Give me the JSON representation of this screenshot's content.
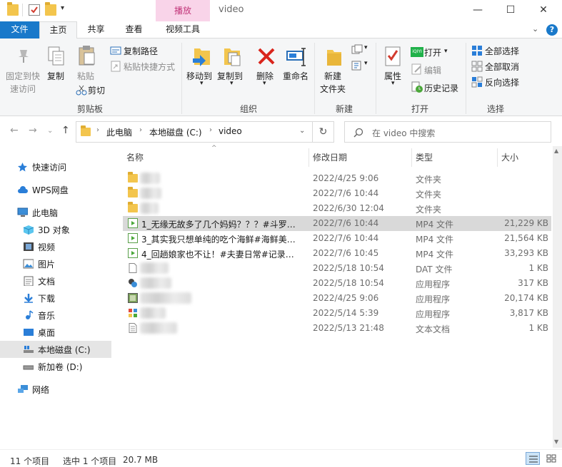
{
  "window": {
    "title": "video",
    "context_tab": "播放"
  },
  "tabs": {
    "file": "文件",
    "home": "主页",
    "share": "共享",
    "view": "查看",
    "video_tools": "视频工具"
  },
  "ribbon": {
    "clipboard": {
      "pin": "固定到快",
      "pin2": "速访问",
      "copy": "复制",
      "paste": "粘贴",
      "copy_path": "复制路径",
      "paste_shortcut": "粘贴快捷方式",
      "cut": "剪切",
      "group": "剪贴板"
    },
    "organize": {
      "move_to": "移动到",
      "copy_to": "复制到",
      "delete": "删除",
      "rename": "重命名",
      "group": "组织"
    },
    "new": {
      "new_folder": "新建",
      "new_folder2": "文件夹",
      "group": "新建"
    },
    "open": {
      "properties": "属性",
      "open": "打开",
      "edit": "编辑",
      "history": "历史记录",
      "group": "打开"
    },
    "select": {
      "select_all": "全部选择",
      "select_none": "全部取消",
      "invert": "反向选择",
      "group": "选择"
    }
  },
  "address": {
    "crumbs": [
      "此电脑",
      "本地磁盘 (C:)",
      "video"
    ],
    "search_placeholder": "在 video 中搜索"
  },
  "nav": {
    "quick_access": "快速访问",
    "wps": "WPS网盘",
    "this_pc": "此电脑",
    "objects3d": "3D 对象",
    "videos": "视频",
    "pictures": "图片",
    "documents": "文档",
    "downloads": "下载",
    "music": "音乐",
    "desktop": "桌面",
    "local_c": "本地磁盘 (C:)",
    "new_d": "新加卷 (D:)",
    "network": "网络"
  },
  "columns": {
    "name": "名称",
    "date": "修改日期",
    "type": "类型",
    "size": "大小"
  },
  "files": [
    {
      "name": "",
      "date": "2022/4/25 9:06",
      "type": "文件夹",
      "size": "",
      "icon": "folder"
    },
    {
      "name": "",
      "date": "2022/7/6 10:44",
      "type": "文件夹",
      "size": "",
      "icon": "folder"
    },
    {
      "name": "",
      "date": "2022/6/30 12:04",
      "type": "文件夹",
      "size": "",
      "icon": "folder"
    },
    {
      "name": "1_无缘无故多了几个妈妈？？？#斗罗大...",
      "date": "2022/7/6 10:44",
      "type": "MP4 文件",
      "size": "21,229 KB",
      "icon": "video"
    },
    {
      "name": "3_其实我只想单纯的吃个海鲜#海鲜美食...",
      "date": "2022/7/6 10:44",
      "type": "MP4 文件",
      "size": "21,564 KB",
      "icon": "video"
    },
    {
      "name": "4_回趟娘家也不让！#夫妻日常#记录生...",
      "date": "2022/7/6 10:45",
      "type": "MP4 文件",
      "size": "33,293 KB",
      "icon": "video"
    },
    {
      "name": "",
      "date": "2022/5/18 10:54",
      "type": "DAT 文件",
      "size": "1 KB",
      "icon": "file"
    },
    {
      "name": "",
      "date": "2022/5/18 10:54",
      "type": "应用程序",
      "size": "317 KB",
      "icon": "app"
    },
    {
      "name": "",
      "date": "2022/4/25 9:06",
      "type": "应用程序",
      "size": "20,174 KB",
      "icon": "app"
    },
    {
      "name": "",
      "date": "2022/5/14 5:39",
      "type": "应用程序",
      "size": "3,817 KB",
      "icon": "app"
    },
    {
      "name": "",
      "date": "2022/5/13 21:48",
      "type": "文本文档",
      "size": "1 KB",
      "icon": "text"
    }
  ],
  "status": {
    "count": "11 个项目",
    "selected": "选中 1 个项目",
    "size": "20.7 MB"
  }
}
